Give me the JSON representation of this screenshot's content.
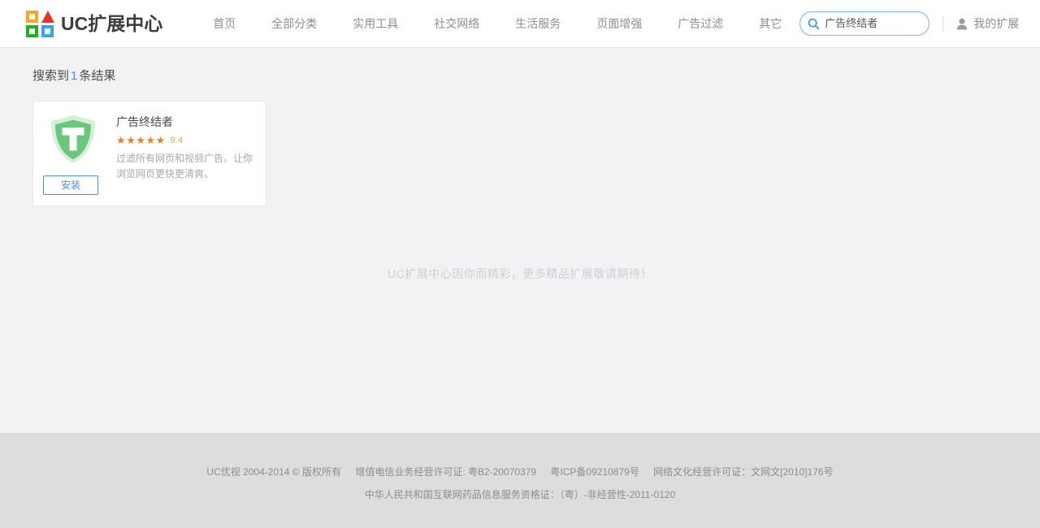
{
  "header": {
    "brand": {
      "name": "UC扩展中心",
      "logo_colors": {
        "orange": "#f5a623",
        "red": "#ea3323",
        "green": "#1db31d",
        "blue": "#32a7ef"
      }
    },
    "nav_items": [
      {
        "label": "首页",
        "name": "nav-home"
      },
      {
        "label": "全部分类",
        "name": "nav-all-categories"
      },
      {
        "label": "实用工具",
        "name": "nav-tools"
      },
      {
        "label": "社交网络",
        "name": "nav-social"
      },
      {
        "label": "生活服务",
        "name": "nav-life-services"
      },
      {
        "label": "页面增强",
        "name": "nav-page-enhance"
      },
      {
        "label": "广告过滤",
        "name": "nav-ad-filter"
      },
      {
        "label": "其它",
        "name": "nav-other"
      }
    ],
    "search": {
      "value": "广告终结者",
      "placeholder": "搜索扩展",
      "icon": "search-icon",
      "border_color": "#7ab8ef"
    },
    "account": {
      "label": "我的扩展",
      "icon": "user-icon"
    }
  },
  "main": {
    "results": {
      "prefix": "搜索到",
      "count": "1",
      "suffix": "条结果",
      "count_color": "#4a90d9"
    },
    "cards": [
      {
        "title": "广告终结者",
        "icon": "shield-t-icon",
        "icon_color": "#5fc16e",
        "stars": "★★★★★",
        "star_color": "#f08019",
        "score": "9.4",
        "description": "过滤所有网页和视频广告。让你浏览网页更快更清爽。",
        "install_label": "安装",
        "install_color": "#4a90d9"
      }
    ],
    "tagline": "UC扩展中心因你而精彩，更多精品扩展敬请期待！"
  },
  "footer": {
    "line1": [
      "UC优视 2004-2014 © 版权所有",
      "增值电信业务经营许可证: 粤B2-20070379",
      "粤ICP备09210879号",
      "网络文化经营许可证：文网文[2010]176号"
    ],
    "line2": "中华人民共和国互联网药品信息服务资格证：（粤）-非经营性-2011-0120"
  }
}
